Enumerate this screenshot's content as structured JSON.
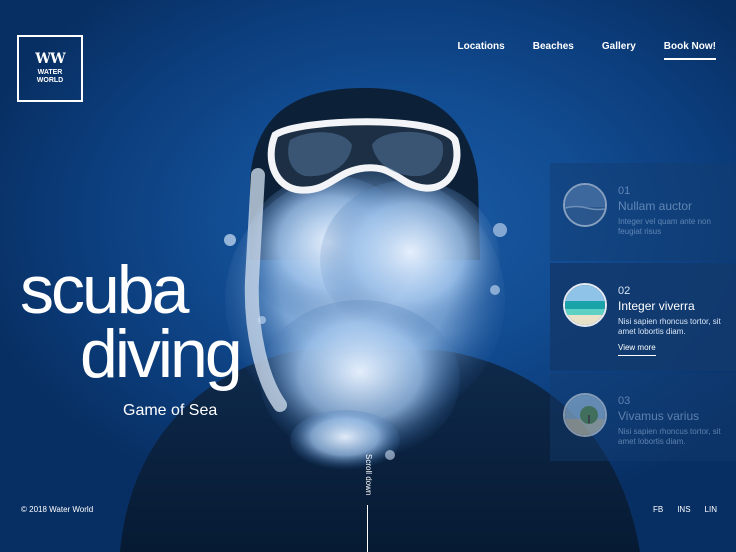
{
  "brand": {
    "mark": "WW",
    "name_line1": "WATER",
    "name_line2": "WORLD"
  },
  "nav": {
    "items": [
      "Locations",
      "Beaches",
      "Gallery",
      "Book Now!"
    ],
    "active": "Book Now!"
  },
  "hero": {
    "line1": "scuba",
    "line2": "diving",
    "subtitle": "Game of Sea"
  },
  "scroll": {
    "label": "Scroll down"
  },
  "footer": {
    "copyright": "© 2018 Water World",
    "socials": [
      "FB",
      "INS",
      "LIN"
    ]
  },
  "cards": [
    {
      "num": "01",
      "title": "Nullam auctor",
      "desc": "Integer vel quam ante non feugiat risus",
      "thumb_icon": "ocean-icon",
      "state": "dim"
    },
    {
      "num": "02",
      "title": "Integer viverra",
      "desc": "Nisi sapien rhoncus tortor, sit amet lobortis diam.",
      "more": "View more",
      "thumb_icon": "beach-icon",
      "state": "active"
    },
    {
      "num": "03",
      "title": "Vivamus varius",
      "desc": "Nisi sapien rhoncus tortor, sit amet lobortis diam.",
      "thumb_icon": "island-icon",
      "state": "dim"
    }
  ],
  "colors": {
    "background": "#0b3d7a",
    "accent": "#ffffff",
    "card_active": "#123a6e"
  }
}
